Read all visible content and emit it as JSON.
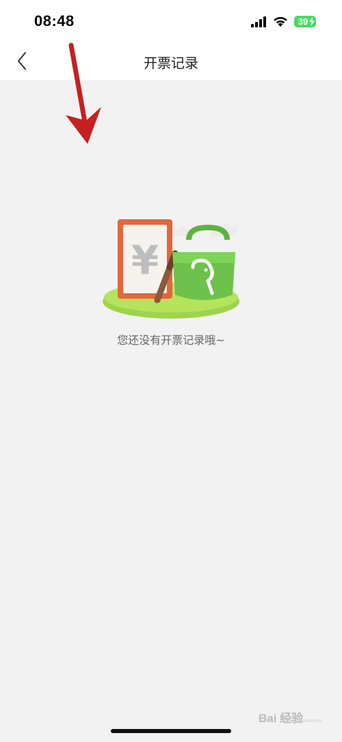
{
  "status_bar": {
    "time": "08:48",
    "battery": "39",
    "icons": [
      "cellular-signal-icon",
      "wifi-icon",
      "battery-charging-icon"
    ]
  },
  "nav": {
    "back_icon": "chevron-left-icon",
    "title": "开票记录"
  },
  "empty_state": {
    "illustration": "invoice-and-shopping-bag-illustration",
    "message": "您还没有开票记录哦~"
  },
  "annotation": {
    "icon": "red-arrow-icon",
    "color": "#c62020"
  },
  "watermark": {
    "text": "Bai 经验",
    "sub": "jingyan.baidu.com"
  },
  "colors": {
    "background": "#f2f2f2",
    "header": "#ffffff",
    "battery": "#4cd964",
    "illustration_green": "#6cc24a",
    "illustration_orange": "#e2673a"
  }
}
